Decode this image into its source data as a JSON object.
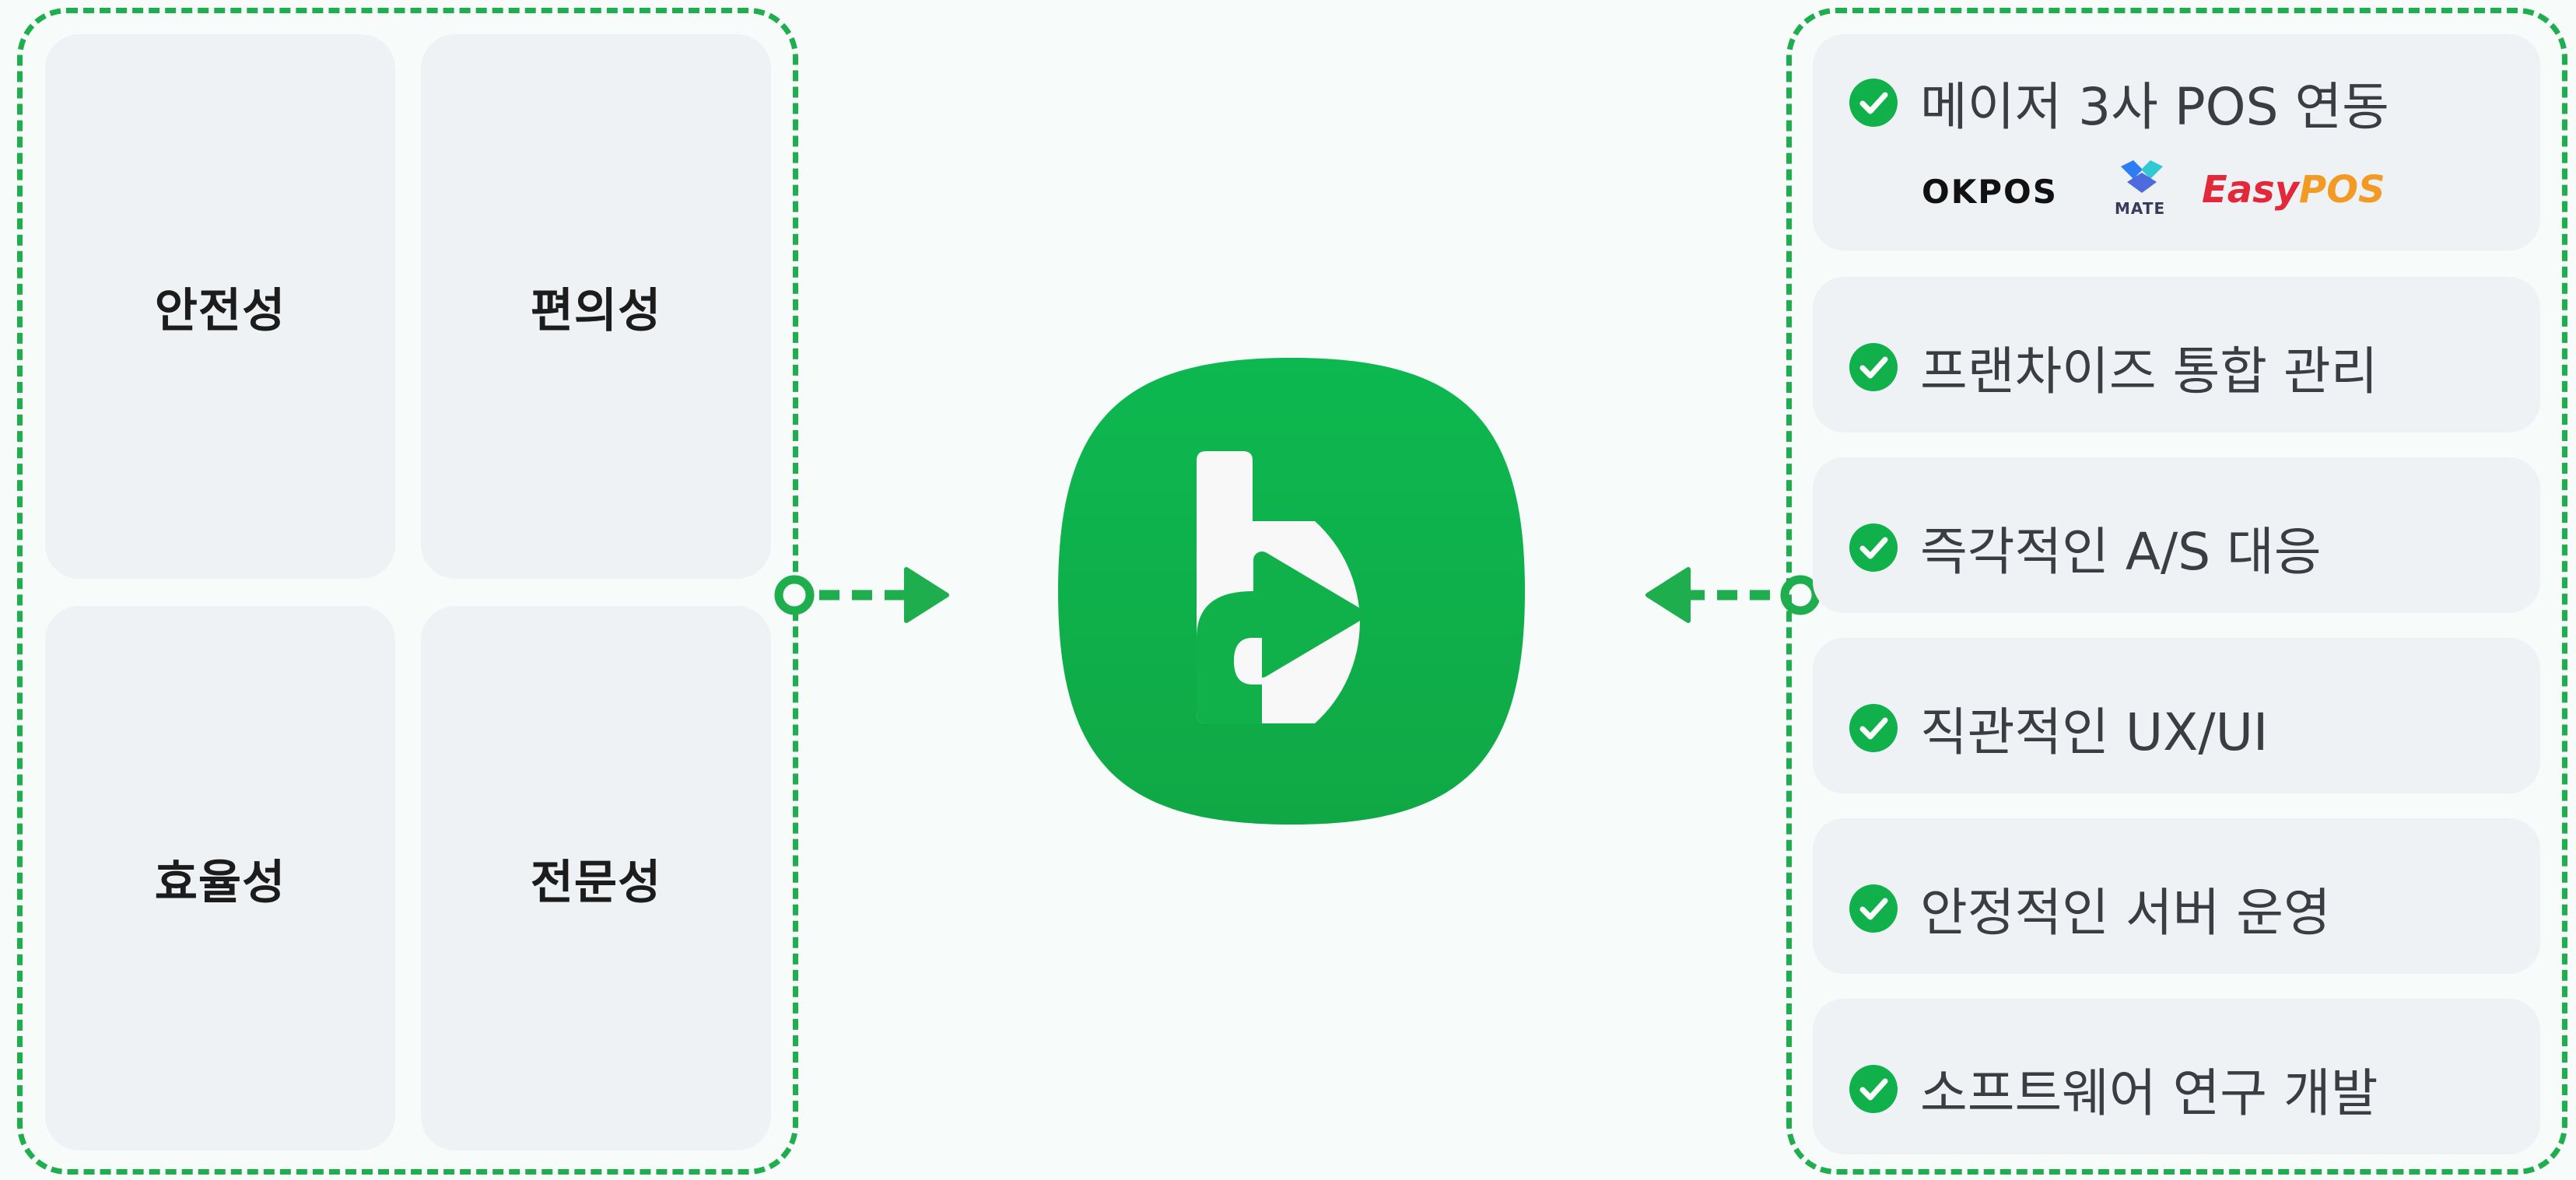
{
  "values": {
    "safety": "안전성",
    "convenience": "편의성",
    "efficiency": "효율성",
    "expertise": "전문성"
  },
  "features": {
    "pos_integration": "메이저 3사 POS 연동",
    "franchise": "프랜차이즈 통합 관리",
    "as_support": "즉각적인 A/S 대응",
    "ux": "직관적인 UX/UI",
    "server": "안정적인 서버 운영",
    "software": "소프트웨어 연구 개발"
  },
  "pos_logos": {
    "okpos": "OKPOS",
    "mate": "MATE",
    "easy": "Easy",
    "pos": "POS"
  },
  "colors": {
    "accent_green": "#1fae4d",
    "icon_green": "#10b14b",
    "card_bg": "#eef2f5",
    "easy_red": "#e3283a",
    "pos_orange": "#f29a24",
    "mate_blue": "#2f7df6",
    "mate_teal": "#31c9d2"
  },
  "icons": {
    "check": "check-circle-icon",
    "app": "b-play-app-icon",
    "arrow_right": "arrow-right-icon",
    "arrow_left": "arrow-left-icon"
  }
}
